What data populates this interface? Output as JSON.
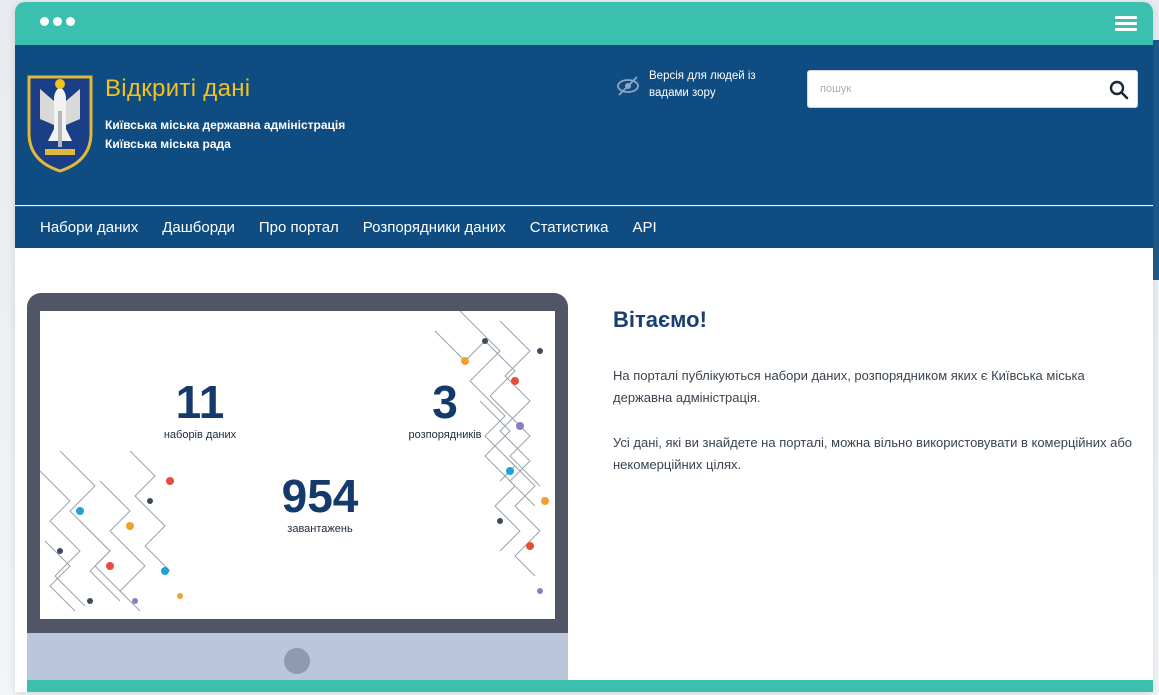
{
  "window": {
    "menu_icon": "hamburger-icon"
  },
  "header": {
    "site_title": "Відкриті дані",
    "subtitle_line1": "Київська міська державна адміністрація",
    "subtitle_line2": "Київська міська рада",
    "vision_label": "Версія для людей із вадами зору",
    "search_placeholder": "пошук",
    "colors": {
      "header_bg": "#0f4c81",
      "title": "#f3c21b",
      "accent": "#3bbfae"
    }
  },
  "nav": {
    "items": [
      {
        "label": "Набори даних"
      },
      {
        "label": "Дашборди"
      },
      {
        "label": "Про портал"
      },
      {
        "label": "Розпорядники даних"
      },
      {
        "label": "Статистика"
      },
      {
        "label": "API"
      }
    ]
  },
  "stats": {
    "datasets_value": "11",
    "datasets_label": "наборів даних",
    "managers_value": "3",
    "managers_label": "розпорядників",
    "downloads_value": "954",
    "downloads_label": "завантажень"
  },
  "welcome": {
    "title": "Вітаємо!",
    "paragraph1": "На порталі публікуються набори даних, розпорядником яких є Київська міська державна адміністрація.",
    "paragraph2": "Усі дані, які ви знайдете на порталі, можна вільно використовувати в комерційних або некомерційних цілях."
  }
}
